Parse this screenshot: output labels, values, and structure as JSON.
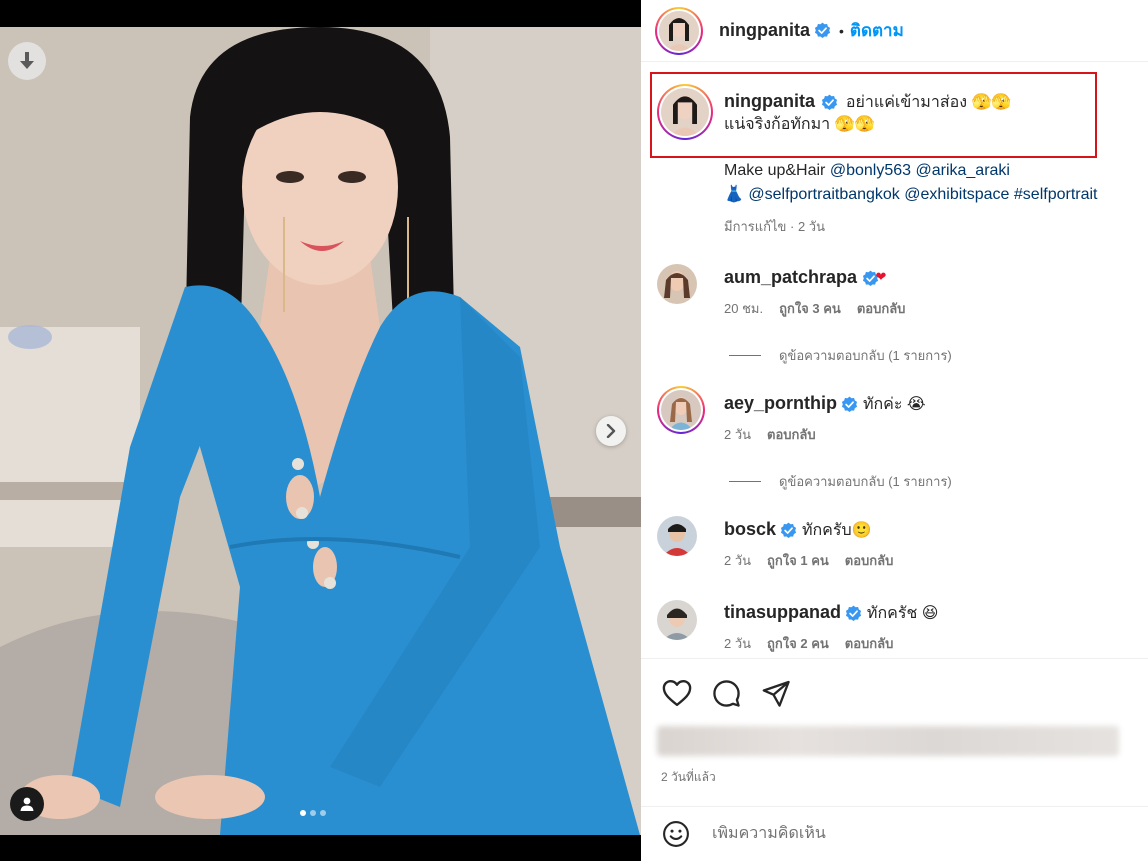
{
  "post": {
    "author": "ningpanita",
    "follow_label": "ติดตาม",
    "dot": "•",
    "caption_line1": "อย่าแค่เข้ามาส่อง 🫣🫣",
    "caption_line2": "แน่จริงก้อทักมา 🫣🫣",
    "credits_line1_prefix": "Make up&Hair ",
    "credits_mention1": "@bonly563",
    "credits_mention2": "@arika_araki",
    "credits_dress_emoji": "👗",
    "credits_mention3": "@selfportraitbangkok",
    "credits_mention4": "@exhibitspace",
    "credits_hashtag": "#selfportrait",
    "edited_meta": "มีการแก้ไข · 2 วัน",
    "posted_ago": "2 วันที่แล้ว"
  },
  "comments": [
    {
      "user": "aum_patchrapa",
      "text": "",
      "badge_heart": "❤",
      "time": "20 ชม.",
      "likes": "ถูกใจ 3 คน",
      "reply": "ตอบกลับ",
      "view_replies": "ดูข้อความตอบกลับ (1 รายการ)"
    },
    {
      "user": "aey_pornthip",
      "text": "ทักค่ะ 😭",
      "time": "2 วัน",
      "likes": "",
      "reply": "ตอบกลับ",
      "view_replies": "ดูข้อความตอบกลับ (1 รายการ)"
    },
    {
      "user": "bosck",
      "text": "ทักครับ🙂",
      "time": "2 วัน",
      "likes": "ถูกใจ 1 คน",
      "reply": "ตอบกลับ"
    },
    {
      "user": "tinasuppanad",
      "text": "ทักครัช 😆",
      "time": "2 วัน",
      "likes": "ถูกใจ 2 คน",
      "reply": "ตอบกลับ"
    }
  ],
  "composer": {
    "placeholder": "เพิ่มความคิดเห็น"
  },
  "icons": {
    "download": "download-icon",
    "next": "chevron-right-icon",
    "user_tags": "person-icon",
    "like": "heart-icon",
    "comment": "comment-icon",
    "share": "send-icon",
    "emoji": "smiley-icon",
    "verified": "verified-badge-icon"
  },
  "colors": {
    "link": "#00376b",
    "follow": "#0095f6",
    "verified": "#3897f0",
    "highlight_border": "#d8141b",
    "dress": "#2a8fd0"
  },
  "carousel": {
    "slides": 3,
    "active": 0
  }
}
